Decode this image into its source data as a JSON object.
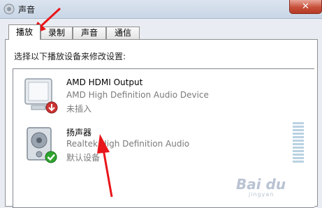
{
  "window": {
    "title": "声音"
  },
  "tabs": [
    {
      "label": "播放",
      "active": true
    },
    {
      "label": "录制",
      "active": false
    },
    {
      "label": "声音",
      "active": false
    },
    {
      "label": "通信",
      "active": false
    }
  ],
  "instruction": "选择以下播放设备来修改设置:",
  "devices": [
    {
      "name": "AMD HDMI Output",
      "description": "AMD High Definition Audio Device",
      "status": "未插入",
      "icon": "monitor-icon",
      "badge": "unplugged-arrow-icon"
    },
    {
      "name": "扬声器",
      "description": "Realtek High Definition Audio",
      "status": "默认设备",
      "icon": "speaker-icon",
      "badge": "default-check-icon"
    }
  ],
  "watermark": {
    "text": "Bai du",
    "sub": "jingyan"
  },
  "colors": {
    "arrow": "#e8151a",
    "close_button": "#c7503a",
    "check": "#2fa52f"
  }
}
